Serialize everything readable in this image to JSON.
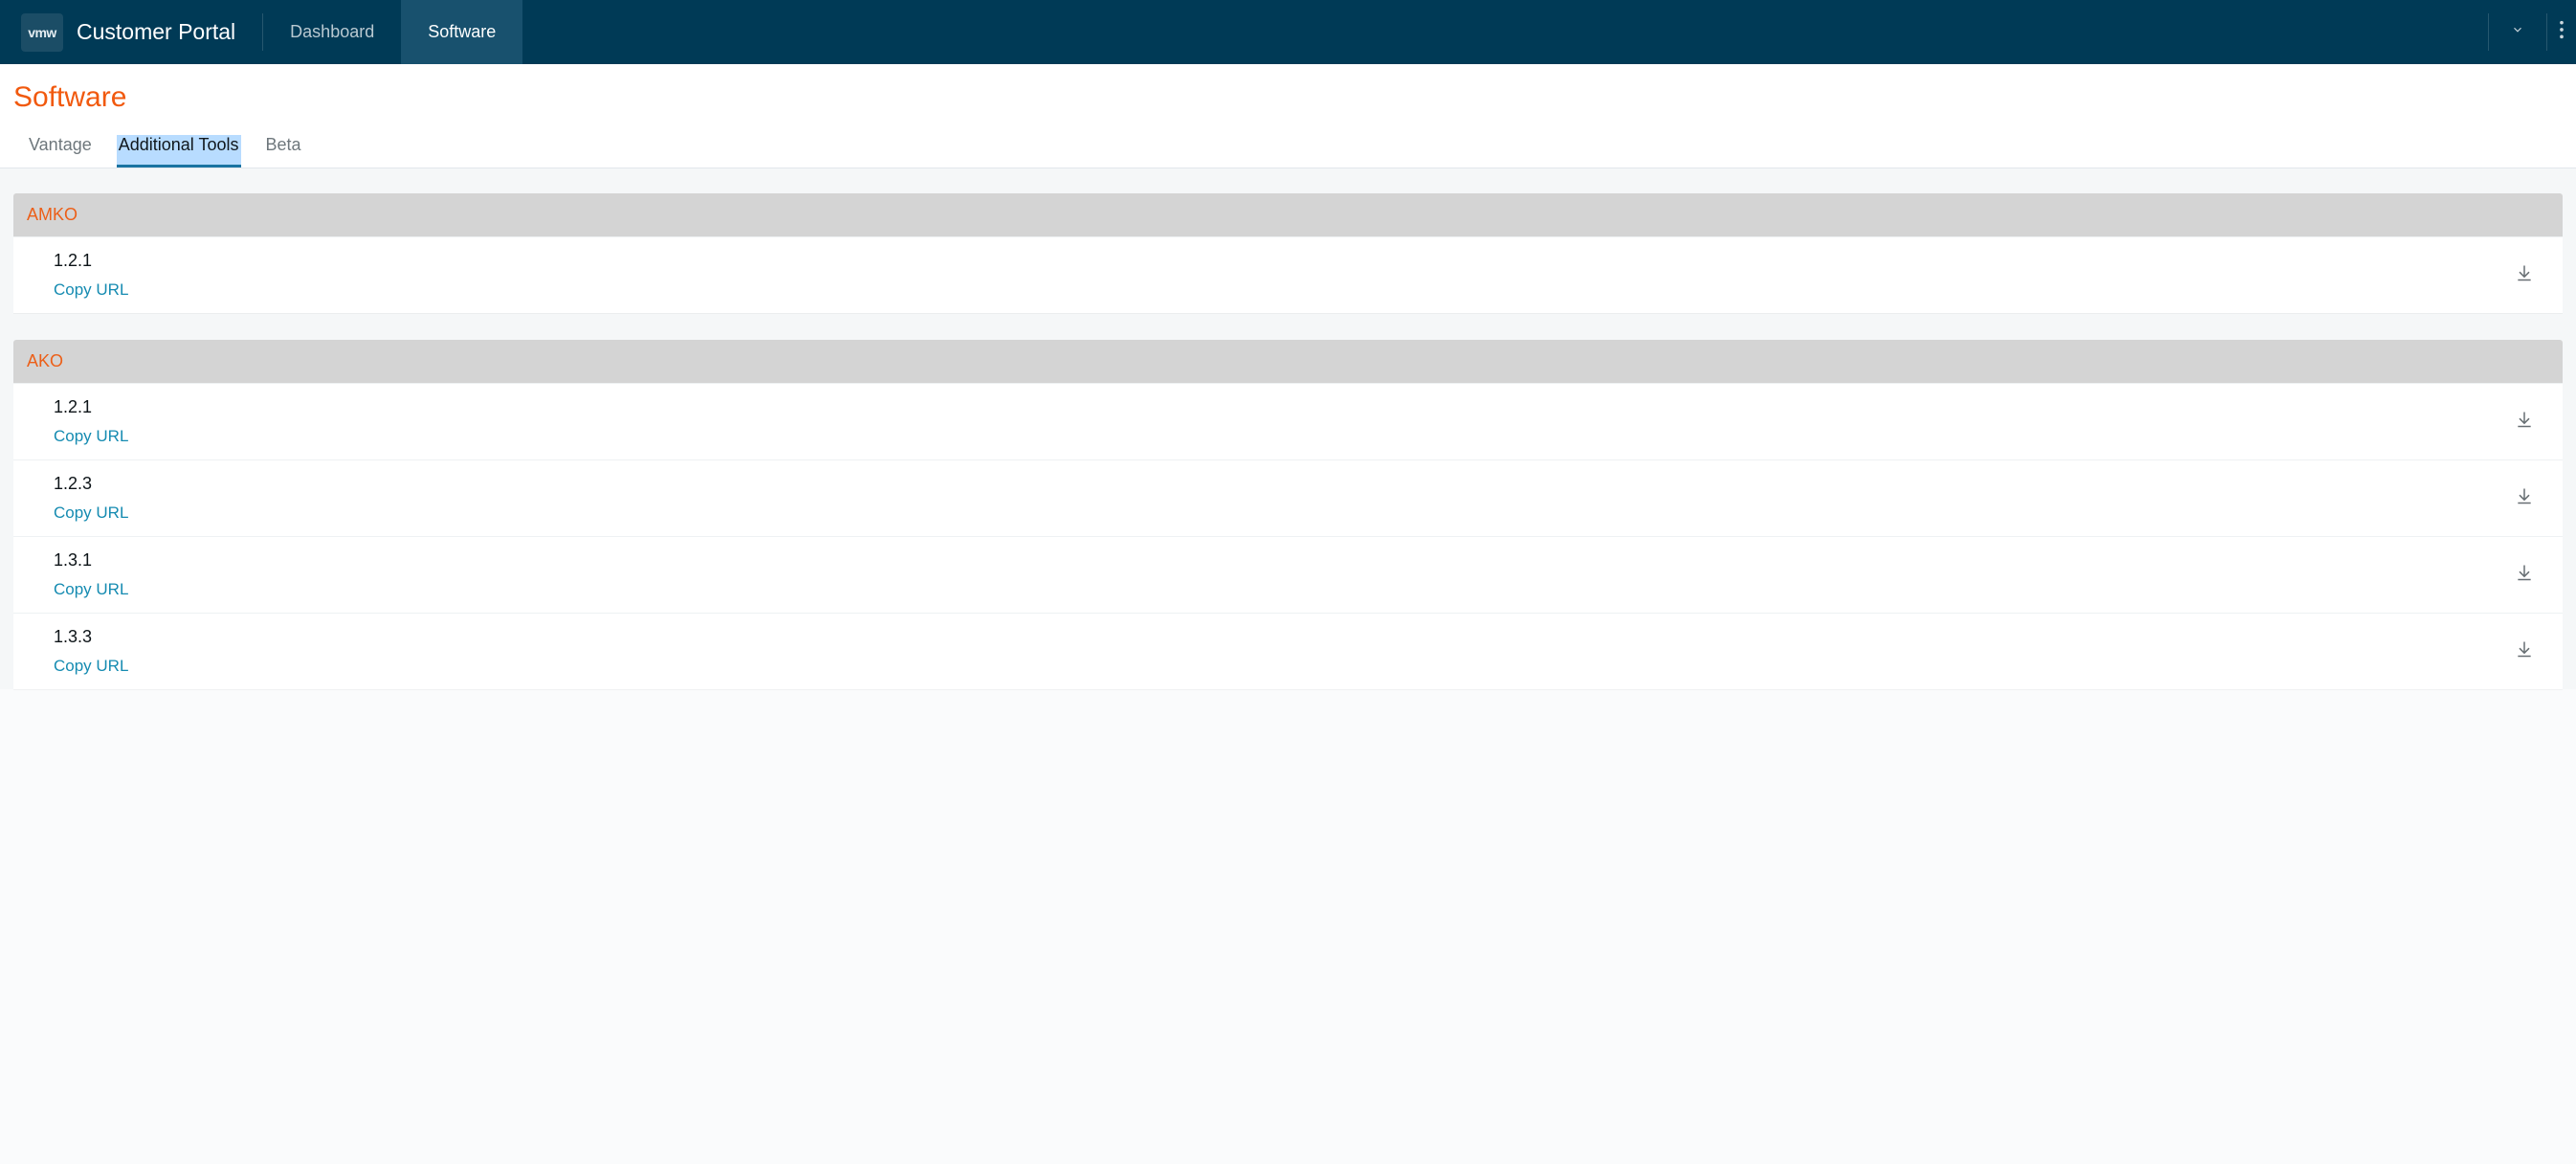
{
  "brand": {
    "logo_text": "vmw",
    "title": "Customer Portal"
  },
  "nav": {
    "items": [
      {
        "label": "Dashboard",
        "active": false
      },
      {
        "label": "Software",
        "active": true
      }
    ]
  },
  "page": {
    "title": "Software"
  },
  "tabs": {
    "items": [
      {
        "label": "Vantage",
        "active": false
      },
      {
        "label": "Additional Tools",
        "active": true
      },
      {
        "label": "Beta",
        "active": false
      }
    ]
  },
  "common": {
    "copy_url_label": "Copy URL"
  },
  "groups": [
    {
      "name": "AMKO",
      "rows": [
        {
          "version": "1.2.1"
        }
      ]
    },
    {
      "name": "AKO",
      "rows": [
        {
          "version": "1.2.1"
        },
        {
          "version": "1.2.3"
        },
        {
          "version": "1.3.1"
        },
        {
          "version": "1.3.3"
        }
      ]
    }
  ]
}
